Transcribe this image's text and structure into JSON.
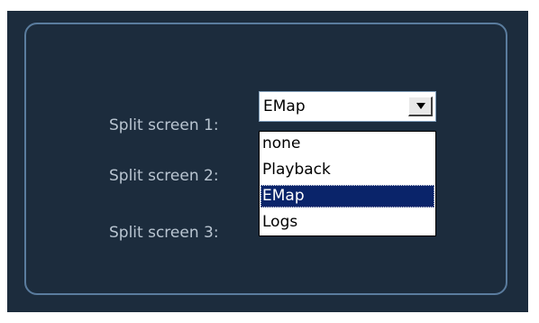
{
  "split_screen": {
    "rows": [
      {
        "label": "Split screen 1:"
      },
      {
        "label": "Split screen 2:"
      },
      {
        "label": "Split screen 3:"
      }
    ],
    "combo_value": "EMap",
    "options": [
      "none",
      "Playback",
      "EMap",
      "Logs"
    ],
    "highlighted_option": "EMap"
  },
  "colors": {
    "panel_background": "#1c2c3d",
    "frame_border": "#5a7c9e",
    "label_text": "#b9c5d1",
    "selection_background": "#0a246a"
  },
  "icons": {
    "combo_arrow": "triangle-down"
  }
}
